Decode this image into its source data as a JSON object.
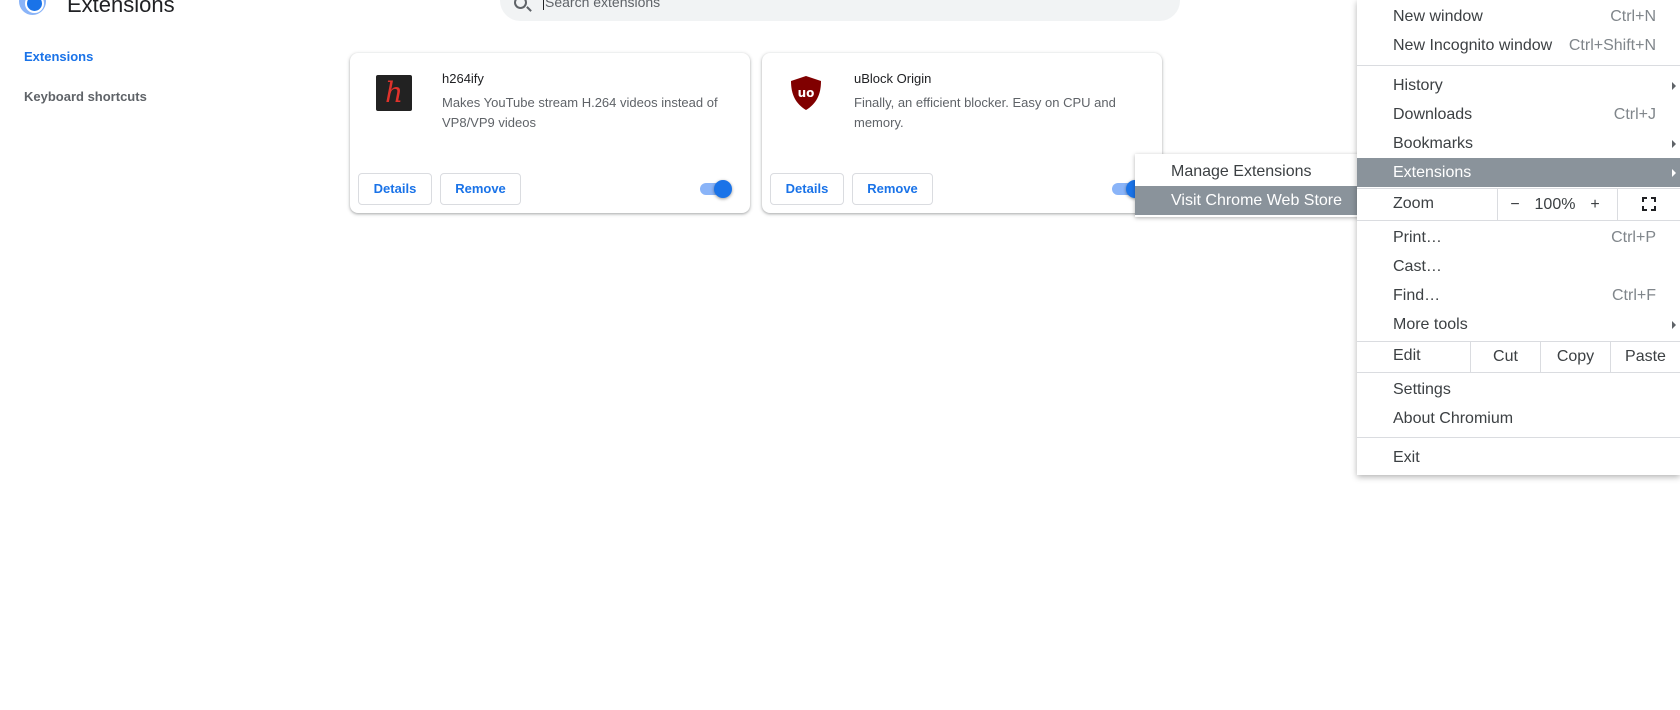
{
  "header": {
    "title": "Extensions",
    "search_placeholder": "Search extensions"
  },
  "sidebar": {
    "items": [
      {
        "label": "Extensions",
        "active": true
      },
      {
        "label": "Keyboard shortcuts",
        "active": false
      }
    ]
  },
  "extensions": [
    {
      "name": "h264ify",
      "description": "Makes YouTube stream H.264 videos instead of VP8/VP9 videos",
      "icon_glyph": "h",
      "enabled": true,
      "details_label": "Details",
      "remove_label": "Remove"
    },
    {
      "name": "uBlock Origin",
      "description": "Finally, an efficient blocker. Easy on CPU and memory.",
      "icon_glyph": "uo",
      "enabled": true,
      "details_label": "Details",
      "remove_label": "Remove"
    }
  ],
  "submenu": {
    "items": [
      {
        "label": "Manage Extensions",
        "highlighted": false
      },
      {
        "label": "Visit Chrome Web Store",
        "highlighted": true
      }
    ]
  },
  "menu": {
    "new_window": {
      "label": "New window",
      "shortcut": "Ctrl+N"
    },
    "new_incognito": {
      "label": "New Incognito window",
      "shortcut": "Ctrl+Shift+N"
    },
    "history": {
      "label": "History"
    },
    "downloads": {
      "label": "Downloads",
      "shortcut": "Ctrl+J"
    },
    "bookmarks": {
      "label": "Bookmarks"
    },
    "extensions": {
      "label": "Extensions"
    },
    "zoom": {
      "label": "Zoom",
      "minus": "−",
      "value": "100%",
      "plus": "+"
    },
    "print": {
      "label": "Print…",
      "shortcut": "Ctrl+P"
    },
    "cast": {
      "label": "Cast…"
    },
    "find": {
      "label": "Find…",
      "shortcut": "Ctrl+F"
    },
    "more_tools": {
      "label": "More tools"
    },
    "edit": {
      "label": "Edit",
      "cut": "Cut",
      "copy": "Copy",
      "paste": "Paste"
    },
    "settings": {
      "label": "Settings"
    },
    "about": {
      "label": "About Chromium"
    },
    "exit": {
      "label": "Exit"
    }
  },
  "colors": {
    "accent": "#1a73e8",
    "highlight": "#8a939b",
    "ublock_red": "#800000",
    "h264_red": "#e0322b"
  }
}
